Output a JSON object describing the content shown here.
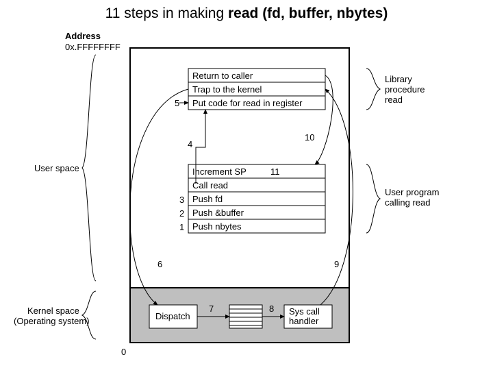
{
  "title_prefix": "11 steps in making ",
  "title_bold": "read (fd, buffer, nbytes)",
  "addr_label": "Address",
  "addr_top": "0x.FFFFFFFF",
  "addr_bottom": "0",
  "user_space": "User space",
  "kernel_space_l1": "Kernel space",
  "kernel_space_l2": "(Operating system)",
  "lib_read_l1": "Library",
  "lib_read_l2": "procedure",
  "lib_read_l3": "read",
  "user_prog_l1": "User program",
  "user_prog_l2": "calling read",
  "top_box": {
    "rows": [
      "Return to caller",
      "Trap to the kernel",
      "Put code for read in register"
    ]
  },
  "bottom_box": {
    "rows": [
      "Increment SP",
      "Call read",
      "Push fd",
      "Push &buffer",
      "Push nbytes"
    ]
  },
  "dispatch": "Dispatch",
  "handler_l1": "Sys call",
  "handler_l2": "handler",
  "step_1": "1",
  "step_2": "2",
  "step_3": "3",
  "step_4": "4",
  "step_5": "5",
  "step_6": "6",
  "step_7": "7",
  "step_8": "8",
  "step_9": "9",
  "step_10": "10",
  "step_11": "11"
}
